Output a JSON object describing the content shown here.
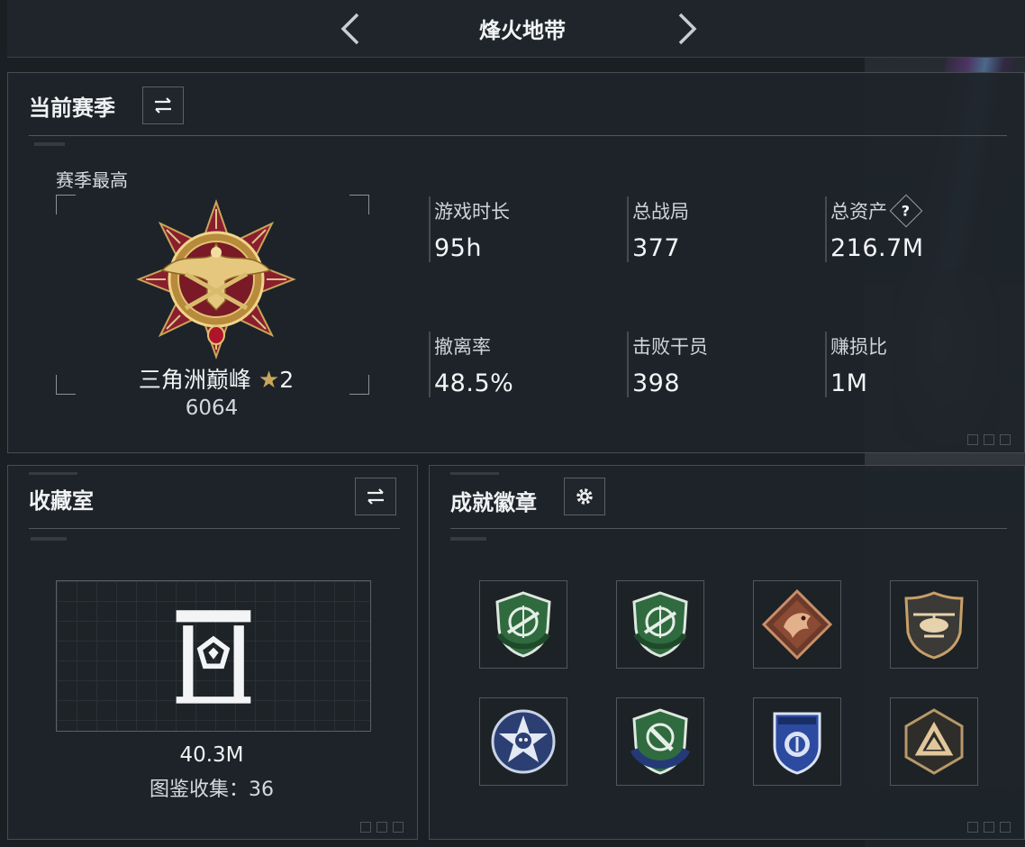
{
  "header": {
    "title": "烽火地带"
  },
  "season": {
    "title": "当前赛季",
    "best_label": "赛季最高",
    "rank_name": "三角洲巅峰",
    "rank_star_level": "2",
    "rank_score": "6064",
    "stats": [
      {
        "label": "游戏时长",
        "value": "95h"
      },
      {
        "label": "总战局",
        "value": "377"
      },
      {
        "label": "总资产",
        "value": "216.7M",
        "help": "?"
      },
      {
        "label": "撤离率",
        "value": "48.5%"
      },
      {
        "label": "击败干员",
        "value": "398"
      },
      {
        "label": "赚损比",
        "value": "1M"
      }
    ]
  },
  "collection": {
    "title": "收藏室",
    "value": "40.3M",
    "count_text": "图鉴收集：36"
  },
  "achievements": {
    "title": "成就徽章",
    "badges": [
      {
        "icon": "green-rifle-shield-badge-icon"
      },
      {
        "icon": "green-rifle-shield-badge-icon"
      },
      {
        "icon": "bronze-dragon-diamond-badge-icon"
      },
      {
        "icon": "helicopter-shield-badge-icon"
      },
      {
        "icon": "skull-star-badge-icon"
      },
      {
        "icon": "blue-target-shield-badge-icon"
      },
      {
        "icon": "police-shield-badge-icon"
      },
      {
        "icon": "triangle-emblem-badge-icon"
      }
    ]
  },
  "colors": {
    "background": "#1a1f24",
    "panel": "#1e2429",
    "border": "#454c52",
    "accent_gold": "#c9a659",
    "accent_red": "#8b1e2e"
  }
}
